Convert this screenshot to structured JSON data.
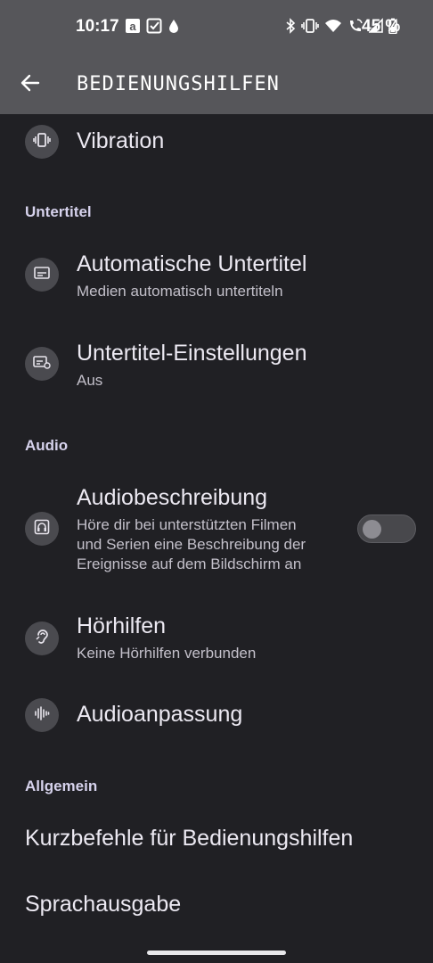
{
  "status_bar": {
    "time": "10:17",
    "battery_percent": "45 %",
    "left_icons": [
      "amazon-icon",
      "task-check-icon",
      "drop-icon"
    ],
    "right_icons": [
      "bluetooth-icon",
      "vibrate-icon",
      "wifi-icon",
      "wifi-calling-icon",
      "signal-icon",
      "battery-icon"
    ]
  },
  "app_bar": {
    "title": "BEDIENUNGSHILFEN"
  },
  "items": {
    "vibration": {
      "title": "Vibration"
    },
    "auto_captions": {
      "title": "Automatische Untertitel",
      "subtitle": "Medien automatisch untertiteln"
    },
    "caption_settings": {
      "title": "Untertitel-Einstellungen",
      "subtitle": "Aus"
    },
    "audio_description": {
      "title": "Audiobeschreibung",
      "subtitle_lines": [
        "Höre dir bei unterstützten Filmen",
        "und Serien eine Beschreibung der",
        "Ereignisse auf dem Bildschirm an"
      ],
      "toggle_on": false
    },
    "hearing_aids": {
      "title": "Hörhilfen",
      "subtitle": "Keine Hörhilfen verbunden"
    },
    "audio_adjustment": {
      "title": "Audioanpassung"
    },
    "shortcuts": {
      "title": "Kurzbefehle für Bedienungshilfen"
    },
    "speech_output": {
      "title": "Sprachausgabe"
    }
  },
  "sections": {
    "captions": "Untertitel",
    "audio": "Audio",
    "general": "Allgemein"
  },
  "colors": {
    "background": "#202024",
    "app_bar": "#56565a",
    "section_header": "#d6d2ec",
    "icon_circle": "#4a4a4f"
  }
}
